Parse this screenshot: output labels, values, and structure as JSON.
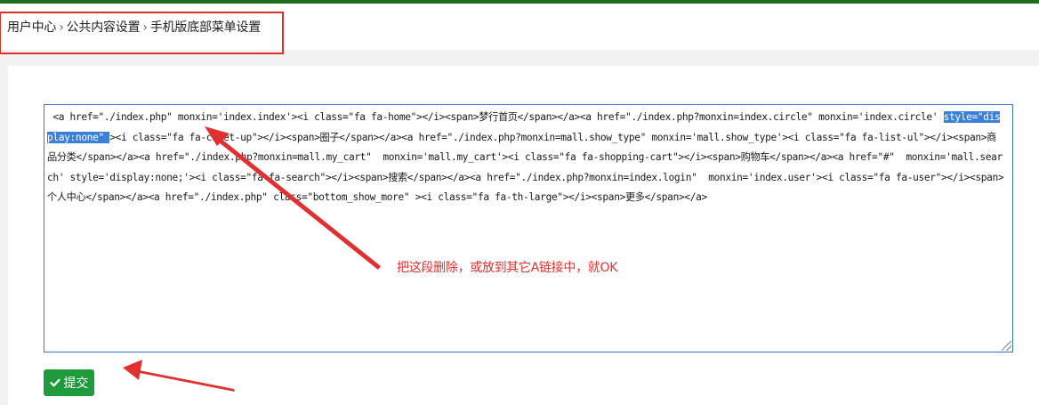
{
  "breadcrumb": {
    "items": [
      "用户中心",
      "公共内容设置",
      "手机版底部菜单设置"
    ],
    "separator": "›"
  },
  "editor": {
    "before_highlight": " <a href=\"./index.php\" monxin='index.index'><i class=\"fa fa-home\"></i><span>梦行首页</span></a><a href=\"./index.php?monxin=index.circle\" monxin='index.circle' ",
    "highlight": "style=\"display:none\" ",
    "after_highlight": "><i class=\"fa fa-caret-up\"></i><span>圈子</span></a><a href=\"./index.php?monxin=mall.show_type\" monxin='mall.show_type'><i class=\"fa fa-list-ul\"></i><span>商品分类</span></a><a href=\"./index.php?monxin=mall.my_cart\"  monxin='mall.my_cart'><i class=\"fa fa-shopping-cart\"></i><span>购物车</span></a><a href=\"#\"  monxin='mall.search' style='display:none;'><i class=\"fa fa-search\"></i><span>搜索</span></a><a href=\"./index.php?monxin=index.login\"  monxin='index.user'><i class=\"fa fa-user\"></i><span>个人中心</span></a><a href=\"./index.php\" class=\"bottom_show_more\" ><i class=\"fa fa-th-large\"></i><span>更多</span></a>"
  },
  "annotation": {
    "text": "把这段删除，或放到其它A链接中，就OK",
    "color": "#e03030"
  },
  "submit": {
    "label": "提交",
    "icon": "check-icon",
    "color": "#1f9a3c"
  },
  "colors": {
    "top_bar": "#1e6b1e",
    "highlight": "#3a7fd8",
    "editor_border": "#3b78c4",
    "markup_red": "#e0302a"
  }
}
